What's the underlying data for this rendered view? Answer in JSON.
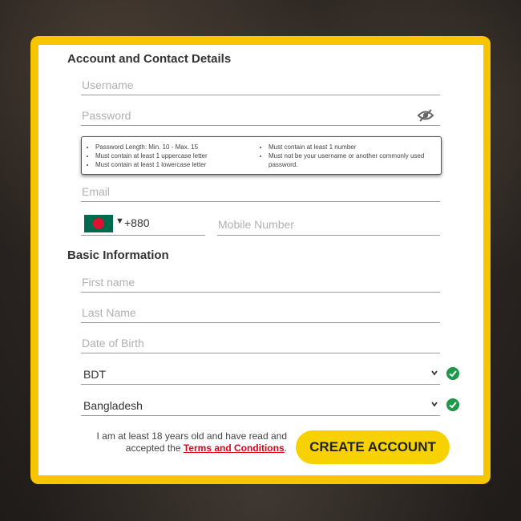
{
  "sections": {
    "account_title": "Account and Contact Details",
    "basic_title": "Basic Information"
  },
  "fields": {
    "username_placeholder": "Username",
    "password_placeholder": "Password",
    "email_placeholder": "Email",
    "dial_code": "+880",
    "mobile_placeholder": "Mobile Number",
    "first_name_placeholder": "First name",
    "last_name_placeholder": "Last Name",
    "dob_placeholder": "Date of Birth"
  },
  "password_hints": {
    "col1": [
      "Password Length: Min. 10 - Max. 15",
      "Must contain at least 1 uppercase letter",
      "Must contain at least 1 lowercase letter"
    ],
    "col2": [
      "Must contain at least 1 number",
      "Must not be your username or another commonly used password."
    ]
  },
  "selects": {
    "currency": "BDT",
    "country": "Bangladesh"
  },
  "icons": {
    "password_toggle": "eye-slash-icon",
    "country_flag": "bangladesh-flag-icon",
    "dropdown": "chevron-down-icon",
    "valid": "check-circle-icon"
  },
  "terms": {
    "text_before": "I am at least 18 years old and have read and accepted the",
    "link": "Terms and Conditions",
    "text_after": "."
  },
  "create_button": "CREATE ACCOUNT",
  "colors": {
    "frame": "#f7c600",
    "button": "#f7d200",
    "link": "#e0001a",
    "valid": "#1c9a4a"
  }
}
